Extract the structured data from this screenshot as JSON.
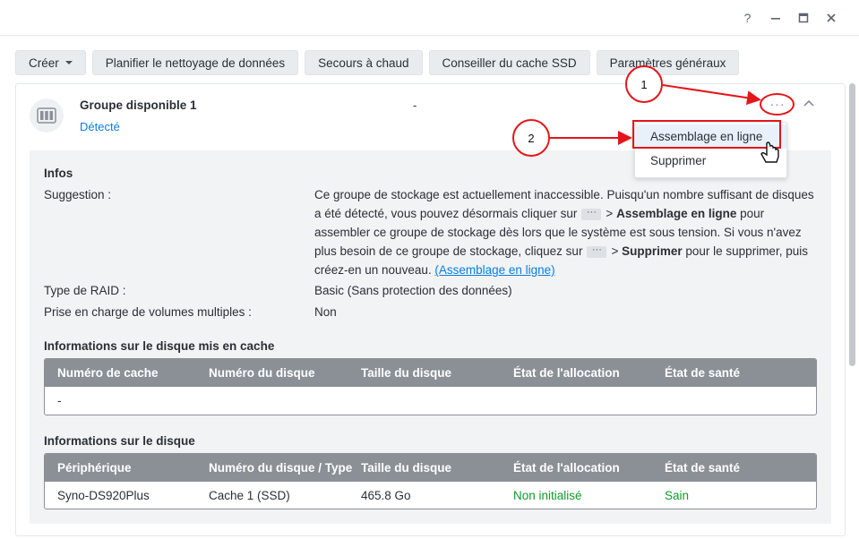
{
  "window": {
    "help_label": "?",
    "minimize_label": "—",
    "maximize_label": "□",
    "close_label": "✕"
  },
  "toolbar": {
    "create_label": "Créer",
    "cleanup_label": "Planifier le nettoyage de données",
    "hotspare_label": "Secours à chaud",
    "ssd_advisor_label": "Conseiller du cache SSD",
    "global_settings_label": "Paramètres généraux"
  },
  "pool": {
    "title": "Groupe disponible 1",
    "status": "Détecté",
    "dash": "-",
    "more_label": "···"
  },
  "menu": {
    "online_assemble_label": "Assemblage en ligne",
    "delete_label": "Supprimer"
  },
  "info": {
    "heading": "Infos",
    "suggestion_label": "Suggestion :",
    "suggestion_p1": "Ce groupe de stockage est actuellement inaccessible. Puisqu'un nombre suffisant de disques a été détecté, vous pouvez désormais cliquer sur",
    "chip": "···",
    "gt": ">",
    "assemble_bold": "Assemblage en ligne",
    "suggestion_p2": "pour assembler ce groupe de stockage dès lors que le système est sous tension. Si vous n'avez plus besoin de ce groupe de stockage, cliquez sur",
    "delete_bold": "Supprimer",
    "suggestion_p3": "pour le supprimer, puis créez-en un nouveau.",
    "help_link": "(Assemblage en ligne)",
    "raid_label": "Type de RAID :",
    "raid_value": "Basic (Sans protection des données)",
    "multi_vol_label": "Prise en charge de volumes multiples :",
    "multi_vol_value": "Non"
  },
  "cache_table": {
    "heading": "Informations sur le disque mis en cache",
    "columns": [
      "Numéro de cache",
      "Numéro du disque",
      "Taille du disque",
      "État de l'allocation",
      "État de santé"
    ],
    "rows": [
      [
        "-",
        "",
        "",
        "",
        ""
      ]
    ]
  },
  "disk_table": {
    "heading": "Informations sur le disque",
    "columns": [
      "Périphérique",
      "Numéro du disque / Type",
      "Taille du disque",
      "État de l'allocation",
      "État de santé"
    ],
    "rows": [
      [
        "Syno-DS920Plus",
        "Cache 1 (SSD)",
        "465.8 Go",
        "Non initialisé",
        "Sain"
      ]
    ]
  },
  "annotations": {
    "step1": "1",
    "step2": "2"
  },
  "colors": {
    "accent": "#0a7ee6",
    "status_green": "#0d9b2a",
    "annotation_red": "#e2171b"
  }
}
